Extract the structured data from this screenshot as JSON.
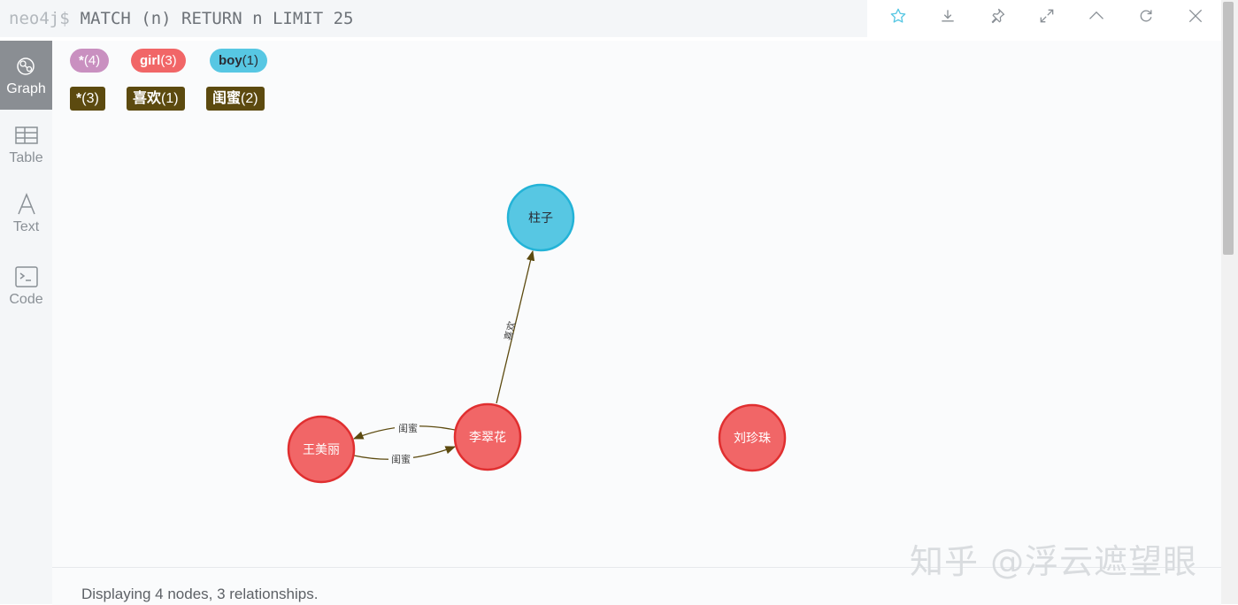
{
  "query": {
    "prompt": "neo4j$",
    "text": "MATCH (n) RETURN n LIMIT 25"
  },
  "toolbar": [
    "star-icon",
    "download-icon",
    "pin-icon",
    "expand-icon",
    "collapse-icon",
    "refresh-icon",
    "close-icon"
  ],
  "sidenav": [
    {
      "label": "Graph",
      "active": true
    },
    {
      "label": "Table",
      "active": false
    },
    {
      "label": "Text",
      "active": false
    },
    {
      "label": "Code",
      "active": false
    }
  ],
  "labels": [
    {
      "name": "*",
      "count": "(4)",
      "color": "#c990c0"
    },
    {
      "name": "girl",
      "count": "(3)",
      "color": "#f16667"
    },
    {
      "name": "boy",
      "count": "(1)",
      "color": "#57c7e3"
    }
  ],
  "reltypes": [
    {
      "name": "*",
      "count": "(3)"
    },
    {
      "name": "喜欢",
      "count": "(1)"
    },
    {
      "name": "闺蜜",
      "count": "(2)"
    }
  ],
  "nodes": [
    {
      "id": "n1",
      "caption": "柱子",
      "label": "boy"
    },
    {
      "id": "n2",
      "caption": "王美丽",
      "label": "girl"
    },
    {
      "id": "n3",
      "caption": "李翠花",
      "label": "girl"
    },
    {
      "id": "n4",
      "caption": "刘珍珠",
      "label": "girl"
    }
  ],
  "relationships": [
    {
      "from": "n3",
      "to": "n1",
      "type": "喜欢"
    },
    {
      "from": "n3",
      "to": "n2",
      "type": "闺蜜"
    },
    {
      "from": "n2",
      "to": "n3",
      "type": "闺蜜"
    }
  ],
  "colors": {
    "girl": "#f16667",
    "girl_border": "#e02f30",
    "boy": "#57c7e3",
    "boy_border": "#23b3d7",
    "rel": "#5c4a0f"
  },
  "footer": "Displaying 4 nodes, 3 relationships.",
  "watermark": "知乎 @浮云遮望眼"
}
